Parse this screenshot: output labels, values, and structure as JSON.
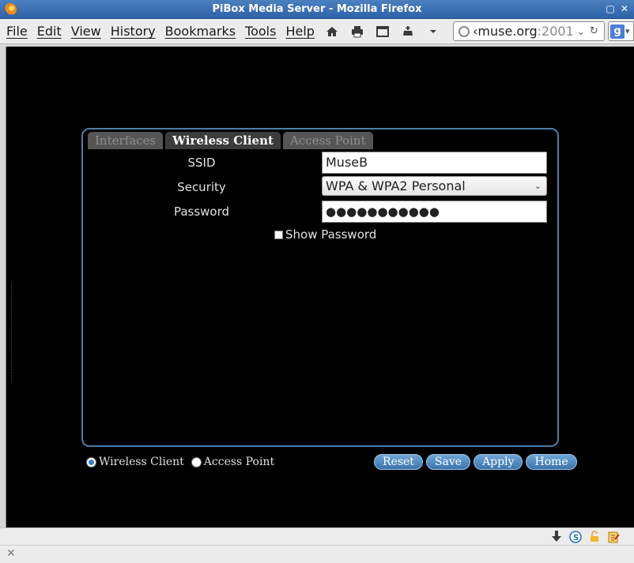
{
  "window": {
    "title": "PiBox Media Server - Mozilla Firefox",
    "minimize_glyph": "▢",
    "close_glyph": "✕"
  },
  "menubar": {
    "items": [
      "File",
      "Edit",
      "View",
      "History",
      "Bookmarks",
      "Tools",
      "Help"
    ]
  },
  "toolbar": {
    "url_host": "‹muse.org",
    "url_port": ":2001",
    "url_drop": "⌄",
    "reload_glyph": "↻",
    "search_engine": "g"
  },
  "page": {
    "tabs": [
      "Interfaces",
      "Wireless Client",
      "Access Point"
    ],
    "active_tab": "Wireless Client",
    "form": {
      "ssid_label": "SSID",
      "ssid_value": "MuseB",
      "security_label": "Security",
      "security_value": "WPA & WPA2 Personal",
      "password_label": "Password",
      "password_mask": "●●●●●●●●●●●",
      "show_password_label": "Show Password"
    },
    "modes": {
      "wireless_client": "Wireless Client",
      "access_point": "Access Point",
      "selected": "Wireless Client"
    },
    "actions": {
      "reset": "Reset",
      "save": "Save",
      "apply": "Apply",
      "home": "Home"
    }
  },
  "statusbar": {
    "close_glyph": "✕"
  },
  "colors": {
    "panel_border": "#4a7ea8",
    "button_bg": "#4f8ac2",
    "titlebar": "#3a6fb4"
  }
}
